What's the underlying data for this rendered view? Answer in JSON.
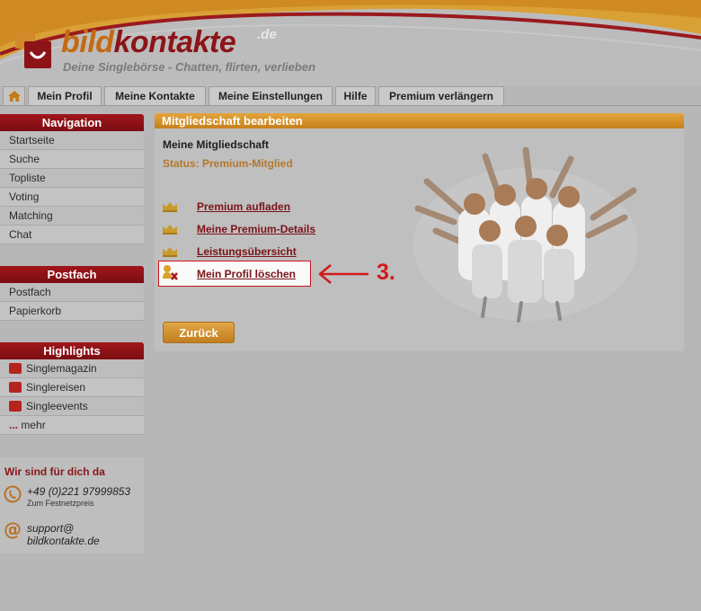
{
  "brand": {
    "name_part1": "bild",
    "name_part2": "kontakte",
    "tld": ".de",
    "slogan": "Deine Singlebörse - Chatten, flirten, verlieben"
  },
  "tabs": [
    {
      "label": "Mein Profil"
    },
    {
      "label": "Meine Kontakte"
    },
    {
      "label": "Meine Einstellungen"
    },
    {
      "label": "Hilfe"
    },
    {
      "label": "Premium verlängern"
    }
  ],
  "sidebar": {
    "navigation": {
      "title": "Navigation",
      "items": [
        "Startseite",
        "Suche",
        "Topliste",
        "Voting",
        "Matching",
        "Chat"
      ]
    },
    "postfach": {
      "title": "Postfach",
      "items": [
        "Postfach",
        "Papierkorb"
      ]
    },
    "highlights": {
      "title": "Highlights",
      "items": [
        "Singlemagazin",
        "Singlereisen",
        "Singleevents"
      ],
      "more_label": "mehr",
      "more_dots": "..."
    },
    "contact": {
      "title": "Wir sind für dich da",
      "phone": "+49 (0)221 97999853",
      "phone_note": "Zum Festnetzpreis",
      "email_line1": "support@",
      "email_line2": "bildkontakte.de"
    }
  },
  "main": {
    "panel_title": "Mitgliedschaft bearbeiten",
    "section_title": "Meine Mitgliedschaft",
    "status": "Status: Premium-Mitglied",
    "links": [
      "Premium aufladen",
      "Meine Premium-Details",
      "Leistungsübersicht",
      "Mein Profil löschen"
    ],
    "back_button": "Zurück"
  },
  "annotation": {
    "step_label": "3."
  },
  "colors": {
    "brand_orange": "#c46a10",
    "brand_red": "#8c1418",
    "nav_red": "#a0161b",
    "panel_orange": "#d9952e",
    "annotation_red": "#d21a1a"
  }
}
